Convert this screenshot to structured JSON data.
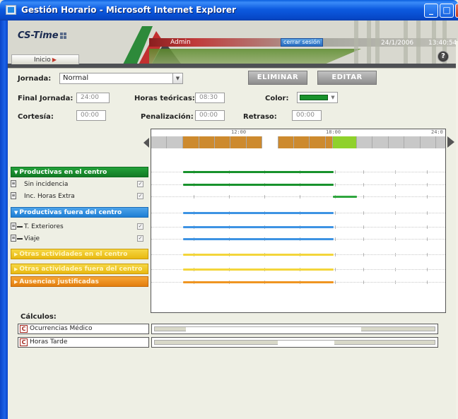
{
  "window": {
    "title": "Gestión Horario - Microsoft Internet Explorer",
    "minimize": "_",
    "maximize": "□",
    "close": "X"
  },
  "header": {
    "logo": "CS-Time",
    "user": "Admin",
    "logout": "cerrar sesión",
    "date": "24/1/2006",
    "time": "13:40:54",
    "help": "?",
    "nav_tab": "Inicio"
  },
  "form": {
    "jornada_label": "Jornada:",
    "jornada_value": "Normal",
    "eliminar": "ELIMINAR",
    "editar": "EDITAR",
    "final_label": "Final Jornada:",
    "final_value": "24:00",
    "horas_label": "Horas teóricas:",
    "horas_value": "08:30",
    "color_label": "Color:",
    "color_value": "#18922c",
    "cortesia_label": "Cortesía:",
    "cortesia_value": "00:00",
    "penal_label": "Penalización:",
    "penal_value": "00:00",
    "retraso_label": "Retraso:",
    "retraso_value": "00:00"
  },
  "timeline": {
    "labels": [
      "12:00",
      "18:00",
      "24:0"
    ]
  },
  "categories": {
    "prod_centro": "Productivas en el centro",
    "sin_incidencia": "Sin incidencia",
    "inc_horas_extra": "Inc. Horas Extra",
    "prod_fuera": "Productivas fuera del centro",
    "t_exteriores": "T. Exteriores",
    "viaje": "Viaje",
    "otras_centro": "Otras actividades en el centro",
    "otras_fuera": "Otras actividades fuera del centro",
    "ausencias": "Ausencias justificadas"
  },
  "calculos": {
    "title": "Cálculos:",
    "medico": "Ocurrencias Médico",
    "tarde": "Horas Tarde"
  },
  "colors": {
    "green": "#18922c",
    "blue": "#3d93e3",
    "yellow": "#f3d53a",
    "orange": "#ef9521",
    "bar_orange": "#cd8a2e",
    "bar_lightgreen": "#8fd12c"
  }
}
